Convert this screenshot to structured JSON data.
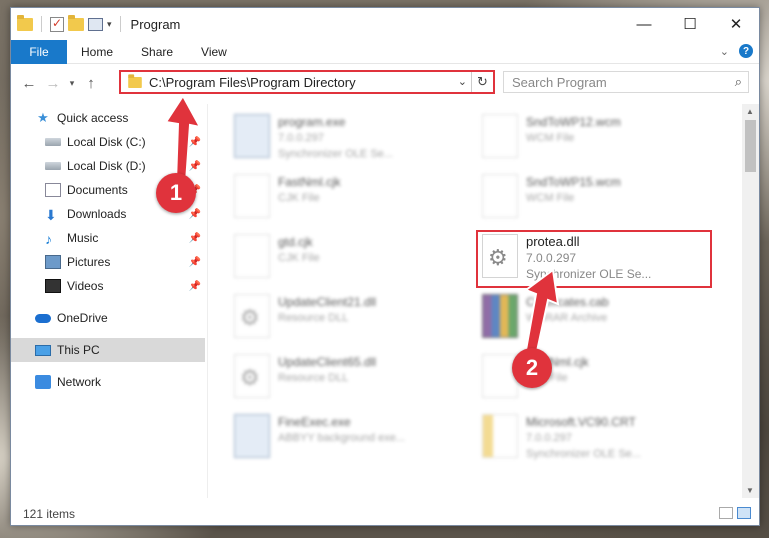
{
  "window": {
    "title": "Program",
    "controls": {
      "minimize": "—",
      "maximize": "☐",
      "close": "✕"
    }
  },
  "ribbon": {
    "tabs": [
      "File",
      "Home",
      "Share",
      "View"
    ]
  },
  "address_bar": {
    "path": "C:\\Program Files\\Program Directory"
  },
  "search": {
    "placeholder": "Search Program"
  },
  "sidebar": {
    "items": [
      {
        "label": "Quick access",
        "icon": "star-icon",
        "pinned": false
      },
      {
        "label": "Local Disk (C:)",
        "icon": "disk-icon",
        "pinned": true
      },
      {
        "label": "Local Disk (D:)",
        "icon": "disk-icon",
        "pinned": true
      },
      {
        "label": "Documents",
        "icon": "documents-icon",
        "pinned": true
      },
      {
        "label": "Downloads",
        "icon": "download-icon",
        "pinned": true
      },
      {
        "label": "Music",
        "icon": "music-icon",
        "pinned": true
      },
      {
        "label": "Pictures",
        "icon": "pictures-icon",
        "pinned": true
      },
      {
        "label": "Videos",
        "icon": "videos-icon",
        "pinned": true
      },
      {
        "label": "OneDrive",
        "icon": "cloud-icon",
        "pinned": false
      },
      {
        "label": "This PC",
        "icon": "pc-icon",
        "pinned": false,
        "active": true
      },
      {
        "label": "Network",
        "icon": "network-icon",
        "pinned": false
      }
    ]
  },
  "files": [
    {
      "name": "program.exe",
      "line2": "7.0.0.297",
      "line3": "Synchronizer OLE Se...",
      "icon": "exe-icon"
    },
    {
      "name": "SndToWP12.wcm",
      "line2": "WCM File",
      "line3": "",
      "icon": "file-icon"
    },
    {
      "name": "FastNml.cjk",
      "line2": "CJK File",
      "line3": "",
      "icon": "file-icon"
    },
    {
      "name": "SndToWP15.wcm",
      "line2": "WCM File",
      "line3": "",
      "icon": "file-icon"
    },
    {
      "name": "gtd.cjk",
      "line2": "CJK File",
      "line3": "",
      "icon": "file-icon"
    },
    {
      "name": "protea.dll",
      "line2": "7.0.0.297",
      "line3": "Synchronizer OLE Se...",
      "icon": "dll-icon"
    },
    {
      "name": "UpdateClient21.dll",
      "line2": "Resource DLL",
      "line3": "",
      "icon": "dll-icon"
    },
    {
      "name": "Certificates.cab",
      "line2": "WinRAR Archive",
      "line3": "",
      "icon": "archive-icon"
    },
    {
      "name": "UpdateClient65.dll",
      "line2": "Resource DLL",
      "line3": "",
      "icon": "dll-icon"
    },
    {
      "name": "FastNml.cjk",
      "line2": "CJK File",
      "line3": "",
      "icon": "file-icon"
    },
    {
      "name": "FineExec.exe",
      "line2": "ABBYY background exe...",
      "line3": "",
      "icon": "exe-icon"
    },
    {
      "name": "Microsoft.VC90.CRT",
      "line2": "7.0.0.297",
      "line3": "Synchronizer OLE Se...",
      "icon": "manifest-icon"
    }
  ],
  "status": {
    "item_count": "121 items"
  },
  "annotations": {
    "step1": "1",
    "step2": "2"
  },
  "colors": {
    "accent": "#1979ca",
    "highlight": "#e0333c"
  }
}
